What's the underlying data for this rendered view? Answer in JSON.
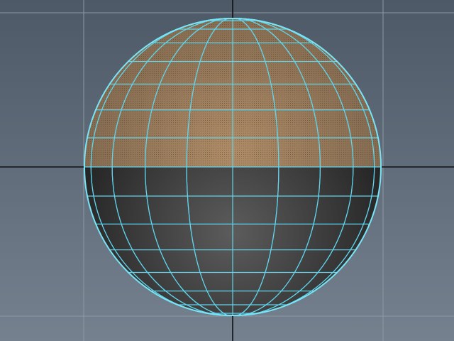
{
  "viewport": {
    "view": "perspective",
    "colors": {
      "background_top": "#4d5966",
      "background_bottom": "#75818e",
      "grid_line": "#8d98a4",
      "axis_line": "#0f1114",
      "wireframe": "#5fd4ec",
      "silhouette": "#7ae3f5",
      "selection_tint": "#b59068",
      "shade_dark": "#1c1c1c",
      "shade_light": "#5c5c5c"
    }
  },
  "scene": {
    "object": {
      "type": "sphere",
      "display_mode": "shaded-wireframe",
      "selection": "upper-faces-selected",
      "icon": "sphere-mesh-icon",
      "subdivisions_axis": 20,
      "subdivisions_height": 16
    }
  }
}
